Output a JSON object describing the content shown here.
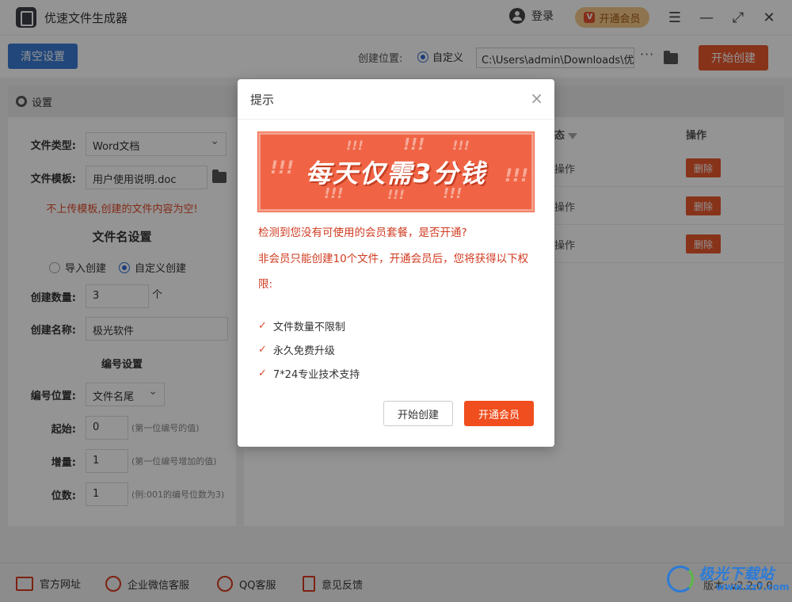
{
  "app": {
    "title": "优速文件生成器"
  },
  "header": {
    "login": "登录",
    "vip_button": "开通会员",
    "vip_icon": "V"
  },
  "toolbar": {
    "clear_label": "清空设置",
    "location_label": "创建位置:",
    "custom_label": "自定义",
    "path_value": "C:\\Users\\admin\\Downloads\\优",
    "more": "···",
    "start_label": "开始创建"
  },
  "settings": {
    "header": "设置",
    "file_type_label": "文件类型:",
    "file_type_value": "Word文档",
    "template_label": "文件模板:",
    "template_value": "用户使用说明.doc",
    "warning": "不上传模板,创建的文件内容为空!",
    "name_section": "文件名设置",
    "import_label": "导入创建",
    "custom_create_label": "自定义创建",
    "count_label": "创建数量:",
    "count_value": "3",
    "count_unit": "个",
    "name_label": "创建名称:",
    "name_value": "极光软件",
    "numbering_section": "编号设置",
    "position_label": "编号位置:",
    "position_value": "文件名尾",
    "start_label": "起始:",
    "start_value": "0",
    "start_hint": "(第一位编号的值)",
    "inc_label": "增量:",
    "inc_value": "1",
    "inc_hint": "(第一位编号增加的值)",
    "digits_label": "位数:",
    "digits_value": "1",
    "digits_hint": "(例:001的编号位数为3)"
  },
  "table": {
    "status_header": "态",
    "op_header": "操作",
    "rows": [
      {
        "op": "操作",
        "delete": "删除"
      },
      {
        "op": "操作",
        "delete": "删除"
      },
      {
        "op": "操作",
        "delete": "删除"
      }
    ]
  },
  "footer": {
    "website": "官方网址",
    "wechat": "企业微信客服",
    "qq": "QQ客服",
    "feedback": "意见反馈",
    "version": "版本: v2.2.0.0"
  },
  "watermark": {
    "text": "极光下载站",
    "url": "www.xz7.com"
  },
  "modal": {
    "title": "提示",
    "close": "×",
    "banner": "每天仅需3分钱",
    "bang": "!!!",
    "msg1": "检测到您没有可使用的会员套餐，是否开通?",
    "msg2": "非会员只能创建10个文件，开通会员后，您将获得以下权限:",
    "perks": [
      "文件数量不限制",
      "永久免费升级",
      "7*24专业技术支持"
    ],
    "check": "✓",
    "btn_start": "开始创建",
    "btn_vip": "开通会员"
  }
}
